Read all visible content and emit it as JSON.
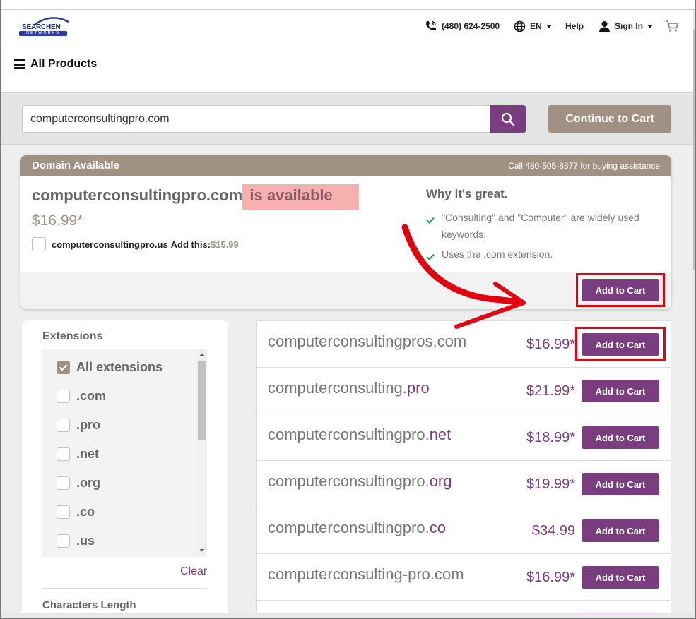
{
  "header": {
    "logo_text": "SEARCHEN",
    "logo_sub": "NETWORKS",
    "phone": "(480) 624-2500",
    "language": "EN",
    "help": "Help",
    "sign_in": "Sign In"
  },
  "nav": {
    "all_products": "All Products"
  },
  "search": {
    "value": "computerconsultingpro.com",
    "continue_label": "Continue to Cart"
  },
  "availability": {
    "heading": "Domain Available",
    "call_text": "Call 480-505-8877 for buying assistance",
    "domain": "computerconsultingpro.com",
    "status": " is available",
    "price": "$16.99*",
    "addon_domain": "computerconsultingpro.us",
    "addon_label": "Add this:",
    "addon_price": "$15.99",
    "why_title": "Why it's great.",
    "reasons": [
      "\"Consulting\" and \"Computer\" are widely used keywords.",
      "Uses the .com extension."
    ],
    "add_label": "Add to Cart"
  },
  "filters": {
    "extensions_title": "Extensions",
    "options": [
      {
        "label": "All extensions",
        "checked": true
      },
      {
        "label": ".com",
        "checked": false
      },
      {
        "label": ".pro",
        "checked": false
      },
      {
        "label": ".net",
        "checked": false
      },
      {
        "label": ".org",
        "checked": false
      },
      {
        "label": ".co",
        "checked": false
      },
      {
        "label": ".us",
        "checked": false
      }
    ],
    "clear": "Clear",
    "chars_title": "Characters Length"
  },
  "results": [
    {
      "base": "computerconsultingpros.com",
      "ext": "",
      "price": "$16.99*",
      "button": "Add to Cart"
    },
    {
      "base": "computerconsulting.",
      "ext": "pro",
      "price": "$21.99*",
      "button": "Add to Cart"
    },
    {
      "base": "computerconsultingpro.",
      "ext": "net",
      "price": "$18.99*",
      "button": "Add to Cart"
    },
    {
      "base": "computerconsultingpro.",
      "ext": "org",
      "price": "$19.99*",
      "button": "Add to Cart"
    },
    {
      "base": "computerconsultingpro.",
      "ext": "co",
      "price": "$34.99",
      "button": "Add to Cart"
    },
    {
      "base": "computerconsulting-pro.com",
      "ext": "",
      "price": "$16.99*",
      "button": "Add to Cart"
    }
  ],
  "colors": {
    "brand_purple": "#7a3d7f",
    "taupe": "#a19183",
    "highlight_red": "#e3000f",
    "check_green": "#1a9b4b"
  }
}
